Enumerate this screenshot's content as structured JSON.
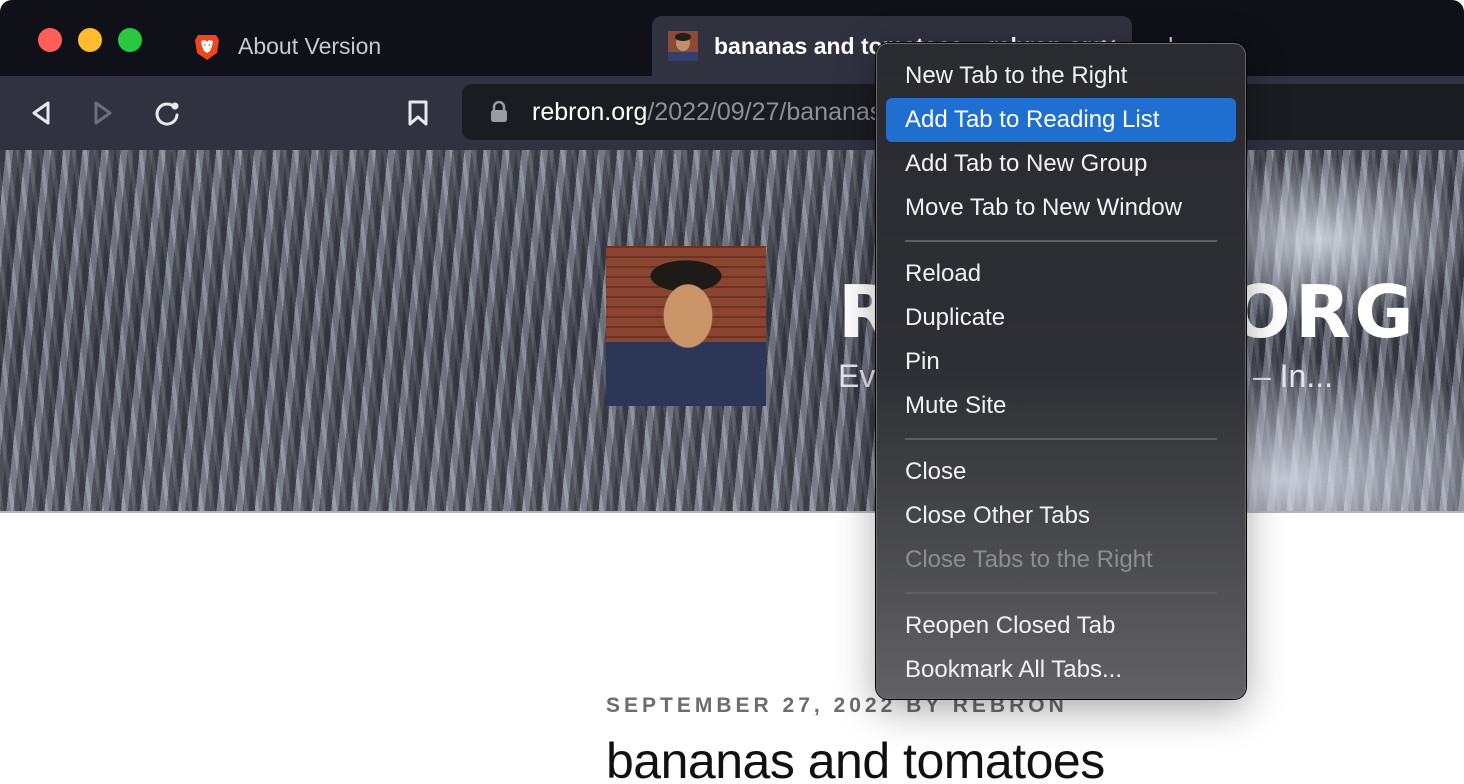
{
  "window": {
    "traffic_lights": [
      "close",
      "minimize",
      "maximize"
    ],
    "colors": {
      "close": "#fe5f57",
      "minimize": "#febc2e",
      "maximize": "#28c840"
    }
  },
  "tabs": [
    {
      "title": "About Version",
      "favicon": "brave-lion-icon",
      "active": false
    },
    {
      "title": "bananas and tomatoes – rebron.org",
      "favicon": "avatar-photo-icon",
      "active": true,
      "close_label": "✕"
    }
  ],
  "new_tab_label": "+",
  "toolbar": {
    "back_icon": "back-arrow-icon",
    "forward_icon": "forward-arrow-icon",
    "reload_icon": "reload-icon",
    "bookmark_icon": "bookmark-icon"
  },
  "omnibox": {
    "lock_icon": "lock-icon",
    "host": "rebron.org",
    "path": "/2022/09/27/bananas-and-tomatoes/"
  },
  "page": {
    "site_title": "REBRON.ORG",
    "site_tagline": "Everything (Browsers | Web) – In...",
    "post_meta": "SEPTEMBER 27, 2022 BY REBRON",
    "post_title": "bananas and tomatoes"
  },
  "context_menu": {
    "highlight_color": "#1f6fd0",
    "groups": [
      [
        {
          "label": "New Tab to the Right",
          "state": "normal"
        },
        {
          "label": "Add Tab to Reading List",
          "state": "highlighted"
        },
        {
          "label": "Add Tab to New Group",
          "state": "normal"
        },
        {
          "label": "Move Tab to New Window",
          "state": "normal"
        }
      ],
      [
        {
          "label": "Reload",
          "state": "normal"
        },
        {
          "label": "Duplicate",
          "state": "normal"
        },
        {
          "label": "Pin",
          "state": "normal"
        },
        {
          "label": "Mute Site",
          "state": "normal"
        }
      ],
      [
        {
          "label": "Close",
          "state": "normal"
        },
        {
          "label": "Close Other Tabs",
          "state": "normal"
        },
        {
          "label": "Close Tabs to the Right",
          "state": "disabled"
        }
      ],
      [
        {
          "label": "Reopen Closed Tab",
          "state": "normal"
        },
        {
          "label": "Bookmark All Tabs...",
          "state": "normal"
        }
      ]
    ]
  }
}
